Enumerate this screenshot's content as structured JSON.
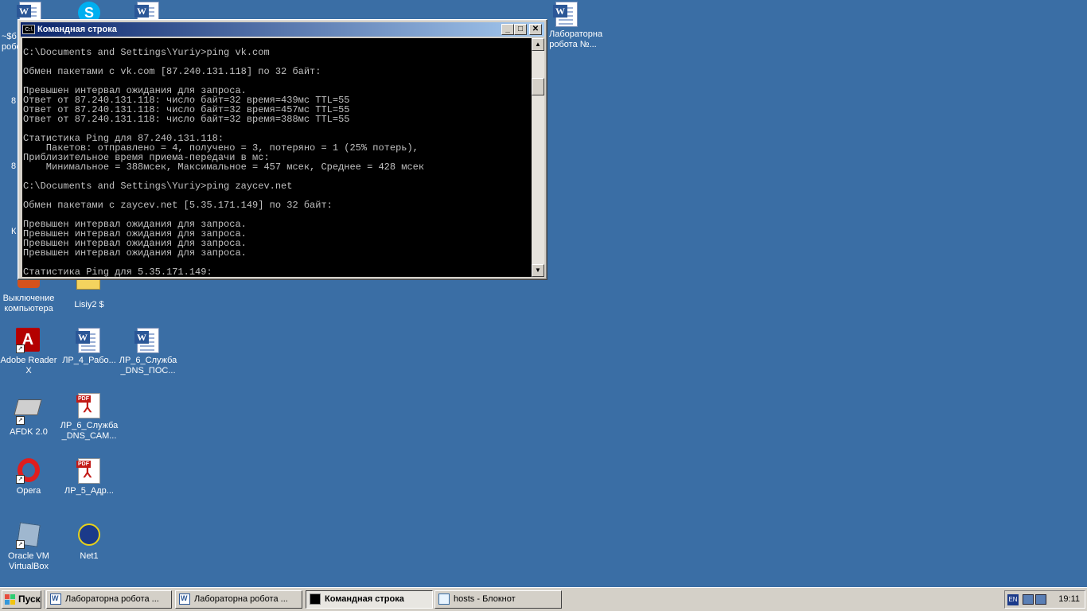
{
  "desktop": {
    "icons": [
      {
        "id": "top-doc-1",
        "label": ""
      },
      {
        "id": "skype",
        "label": ""
      },
      {
        "id": "top-doc-2",
        "label": ""
      },
      {
        "id": "lab-work-doc",
        "label": "Лабораторна робота №..."
      },
      {
        "id": "partial-top",
        "label": "~$б робо"
      },
      {
        "id": "shutdown",
        "label": "Выключение компьютера"
      },
      {
        "id": "lisiy",
        "label": "Lisiy2 $"
      },
      {
        "id": "adobe",
        "label": "Adobe Reader X"
      },
      {
        "id": "lr4",
        "label": "ЛР_4_Рабо..."
      },
      {
        "id": "lr6dns",
        "label": "ЛР_6_Служба _DNS_ПОС..."
      },
      {
        "id": "afdk",
        "label": "AFDK 2.0"
      },
      {
        "id": "lr6sam",
        "label": "ЛР_6_Служба _DNS_САМ..."
      },
      {
        "id": "opera",
        "label": "Opera"
      },
      {
        "id": "lr5",
        "label": "ЛР_5_Адр..."
      },
      {
        "id": "vbox",
        "label": "Oracle VM VirtualBox"
      },
      {
        "id": "net1",
        "label": "Net1"
      }
    ],
    "partial_labels": [
      "8",
      "8",
      "К"
    ]
  },
  "cmd_window": {
    "title": "Командная строка",
    "icon_text": "C:\\",
    "minimize": "_",
    "maximize": "□",
    "close": "✕",
    "lines": [
      "",
      "C:\\Documents and Settings\\Yuriy>ping vk.com",
      "",
      "Обмен пакетами с vk.com [87.240.131.118] по 32 байт:",
      "",
      "Превышен интервал ожидания для запроса.",
      "Ответ от 87.240.131.118: число байт=32 время=439мс TTL=55",
      "Ответ от 87.240.131.118: число байт=32 время=457мс TTL=55",
      "Ответ от 87.240.131.118: число байт=32 время=388мс TTL=55",
      "",
      "Статистика Ping для 87.240.131.118:",
      "    Пакетов: отправлено = 4, получено = 3, потеряно = 1 (25% потерь),",
      "Приблизительное время приема-передачи в мс:",
      "    Минимальное = 388мсек, Максимальное = 457 мсек, Среднее = 428 мсек",
      "",
      "C:\\Documents and Settings\\Yuriy>ping zaycev.net",
      "",
      "Обмен пакетами с zaycev.net [5.35.171.149] по 32 байт:",
      "",
      "Превышен интервал ожидания для запроса.",
      "Превышен интервал ожидания для запроса.",
      "Превышен интервал ожидания для запроса.",
      "Превышен интервал ожидания для запроса.",
      "",
      "Статистика Ping для 5.35.171.149:"
    ],
    "scroll_up": "▲",
    "scroll_down": "▼"
  },
  "taskbar": {
    "start_label": "Пуск",
    "tasks": [
      {
        "label": "Лабораторна робота ...",
        "icon": "word-icon",
        "active": false
      },
      {
        "label": "Лабораторна робота ...",
        "icon": "word-icon",
        "active": false
      },
      {
        "label": "Командная строка",
        "icon": "cmd-icon",
        "active": true
      },
      {
        "label": "hosts - Блокнот",
        "icon": "notepad-icon",
        "active": false
      }
    ],
    "tray": {
      "lang": "EN",
      "time": "19:11"
    }
  }
}
